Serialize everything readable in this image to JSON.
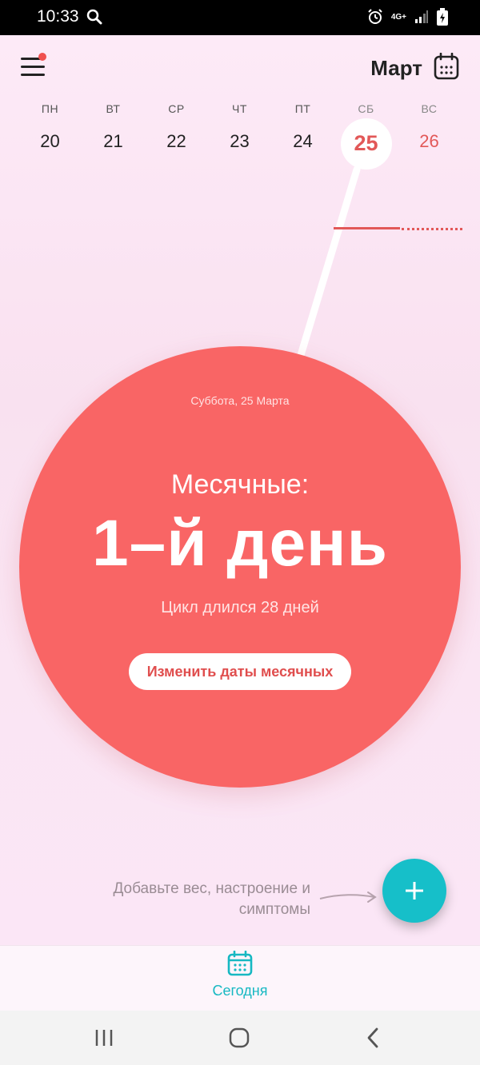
{
  "status_bar": {
    "time": "10:33",
    "network": "4G+"
  },
  "header": {
    "month": "Март"
  },
  "week": {
    "days": [
      {
        "name": "ПН",
        "num": "20"
      },
      {
        "name": "ВТ",
        "num": "21"
      },
      {
        "name": "СР",
        "num": "22"
      },
      {
        "name": "ЧТ",
        "num": "23"
      },
      {
        "name": "ПТ",
        "num": "24"
      },
      {
        "name": "СБ",
        "num": "25"
      },
      {
        "name": "ВС",
        "num": "26"
      }
    ]
  },
  "main": {
    "date": "Суббота, 25 Марта",
    "period_label": "Месячные:",
    "period_day": "1–й день",
    "cycle_text": "Цикл длился 28 дней",
    "edit_button": "Изменить даты месячных"
  },
  "hint": {
    "text": "Добавьте вес, настроение и симптомы"
  },
  "tabs": {
    "today": "Сегодня"
  },
  "colors": {
    "accent": "#f96565",
    "teal": "#16bfc9",
    "background": "#fde8f6"
  }
}
